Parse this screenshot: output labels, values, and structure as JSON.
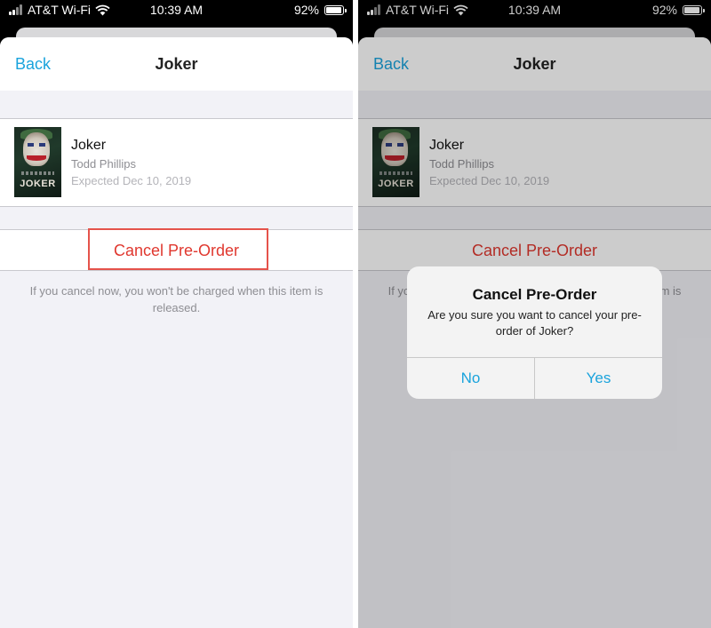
{
  "status_bar": {
    "carrier": "AT&T Wi-Fi",
    "time": "10:39 AM",
    "battery": "92%"
  },
  "nav": {
    "back_label": "Back",
    "title": "Joker"
  },
  "item": {
    "title": "Joker",
    "author": "Todd Phillips",
    "expected": "Expected Dec 10, 2019",
    "poster_text": "JOKER"
  },
  "cancel": {
    "label": "Cancel Pre-Order",
    "note": "If you cancel now, you won't be charged when this item is released."
  },
  "alert": {
    "title": "Cancel Pre-Order",
    "message": "Are you sure you want to cancel your pre-order of Joker?",
    "no_label": "No",
    "yes_label": "Yes"
  },
  "colors": {
    "accent_blue": "#1aa3dc",
    "destructive_red": "#e0382f",
    "highlight_red": "#e5534b",
    "background": "#f2f2f7"
  },
  "icons": [
    "cellular-signal-icon",
    "wifi-icon",
    "battery-icon"
  ]
}
